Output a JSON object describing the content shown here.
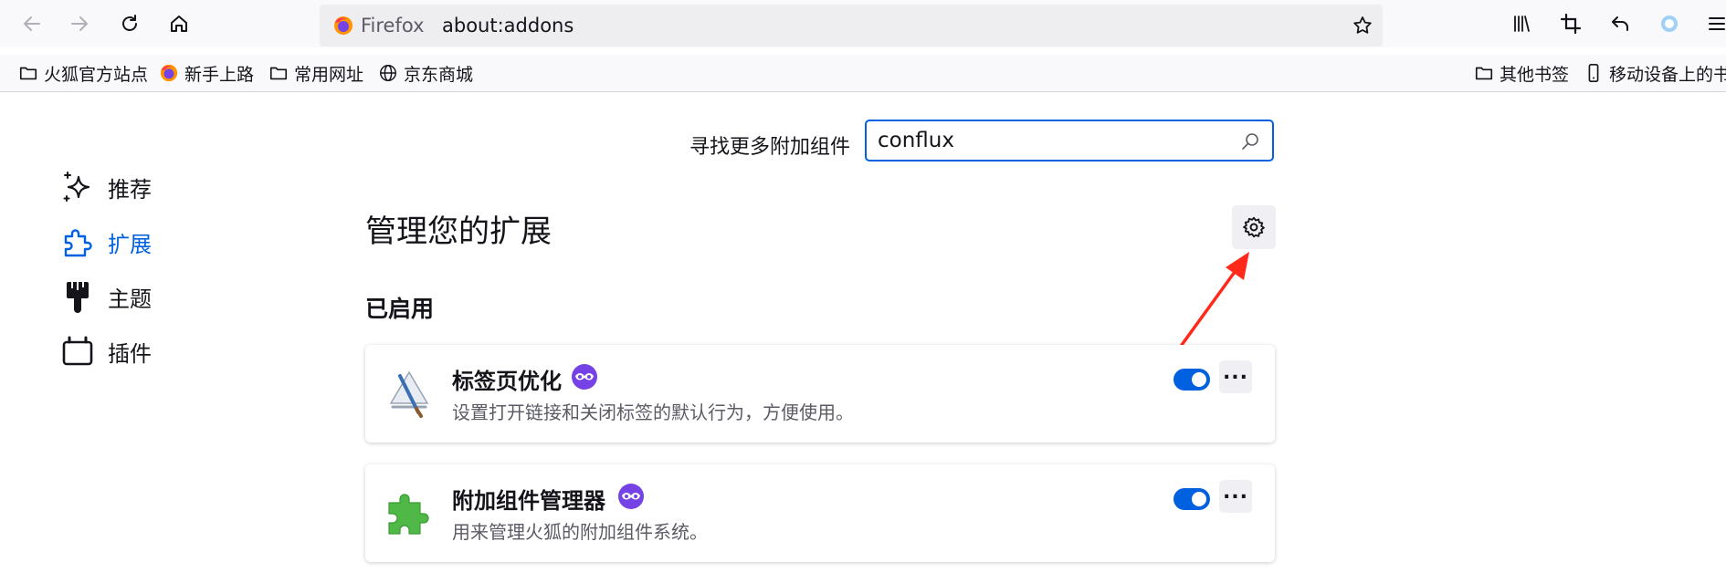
{
  "browser": {
    "identity_label": "Firefox",
    "url": "about:addons"
  },
  "bookmarks": [
    {
      "label": "火狐官方站点",
      "icon": "folder-icon"
    },
    {
      "label": "新手上路",
      "icon": "firefox-icon"
    },
    {
      "label": "常用网址",
      "icon": "folder-icon"
    },
    {
      "label": "京东商城",
      "icon": "globe-icon"
    },
    {
      "label": "其他书签",
      "icon": "folder-icon"
    },
    {
      "label": "移动设备上的书签",
      "icon": "mobile-icon"
    }
  ],
  "search": {
    "label": "寻找更多附加组件",
    "value": "conflux"
  },
  "sidebar": {
    "items": [
      {
        "label": "推荐",
        "icon": "sparkle-icon"
      },
      {
        "label": "扩展",
        "icon": "puzzle-icon",
        "active": true
      },
      {
        "label": "主题",
        "icon": "brush-icon"
      },
      {
        "label": "插件",
        "icon": "plugin-icon"
      }
    ]
  },
  "main": {
    "title": "管理您的扩展",
    "section_enabled": "已启用"
  },
  "extensions": [
    {
      "name": "标签页优化",
      "description": "设置打开链接和关闭标签的默认行为，方便使用。",
      "enabled": true,
      "icon": "tab-tweak-icon"
    },
    {
      "name": "附加组件管理器",
      "description": "用来管理火狐的附加组件系统。",
      "enabled": true,
      "icon": "green-puzzle-icon"
    }
  ],
  "colors": {
    "accent": "#0061e0",
    "badge_purple": "#7542e5",
    "annotation_arrow": "#ff2a1a",
    "puzzle_green": "#4fb847"
  }
}
